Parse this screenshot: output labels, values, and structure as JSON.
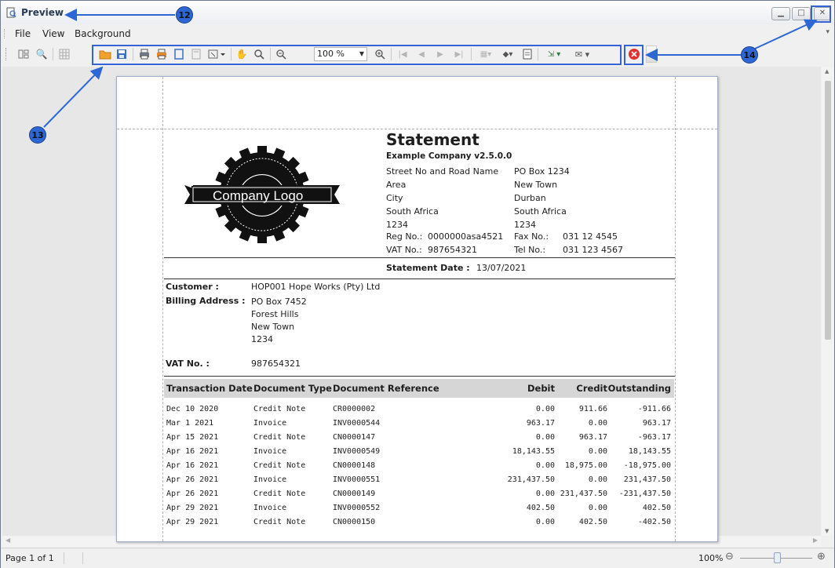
{
  "window": {
    "title": "Preview"
  },
  "menu": {
    "items": [
      "File",
      "View",
      "Background"
    ]
  },
  "toolbar": {
    "zoom_value": "100 %"
  },
  "annotations": [
    "12",
    "13",
    "14"
  ],
  "statusbar": {
    "page_info": "Page 1 of 1",
    "zoom_level": "100%"
  },
  "document": {
    "logo_text": "Company Logo",
    "title": "Statement",
    "company": "Example Company v2.5.0.0",
    "address_left": [
      "Street No and Road Name",
      "Area",
      "City",
      "South Africa",
      "1234"
    ],
    "address_right": [
      "PO Box 1234",
      "New Town",
      "Durban",
      "South Africa",
      "1234"
    ],
    "reg_label": "Reg No.:",
    "reg_value": "0000000asa4521",
    "fax_label": "Fax No.:",
    "fax_value": "031 12 4545",
    "vat_label": "VAT No.:",
    "vat_value": "987654321",
    "tel_label": "Tel No.:",
    "tel_value": "031 123 4567",
    "statement_date_label": "Statement Date :",
    "statement_date": "13/07/2021",
    "customer_label": "Customer :",
    "customer_value": "HOP001 Hope Works (Pty) Ltd",
    "billing_label": "Billing Address :",
    "billing_lines": [
      "PO Box 7452",
      "Forest Hills",
      "New Town",
      "1234"
    ],
    "cust_vat_label": "VAT No. :",
    "cust_vat_value": "987654321",
    "columns": [
      "Transaction Date",
      "Document Type",
      "Document Reference",
      "Debit",
      "Credit",
      "Outstanding"
    ],
    "rows": [
      [
        "Dec 10 2020",
        "Credit Note",
        "CR0000002",
        "0.00",
        "911.66",
        "-911.66"
      ],
      [
        "Mar 1 2021",
        "Invoice",
        "INV0000544",
        "963.17",
        "0.00",
        "963.17"
      ],
      [
        "Apr 15 2021",
        "Credit Note",
        "CN0000147",
        "0.00",
        "963.17",
        "-963.17"
      ],
      [
        "Apr 16 2021",
        "Invoice",
        "INV0000549",
        "18,143.55",
        "0.00",
        "18,143.55"
      ],
      [
        "Apr 16 2021",
        "Credit Note",
        "CN0000148",
        "0.00",
        "18,975.00",
        "-18,975.00"
      ],
      [
        "Apr 26 2021",
        "Invoice",
        "INV0000551",
        "231,437.50",
        "0.00",
        "231,437.50"
      ],
      [
        "Apr 26 2021",
        "Credit Note",
        "CN0000149",
        "0.00",
        "231,437.50",
        "-231,437.50"
      ],
      [
        "Apr 29 2021",
        "Invoice",
        "INV0000552",
        "402.50",
        "0.00",
        "402.50"
      ],
      [
        "Apr 29 2021",
        "Credit Note",
        "CN0000150",
        "0.00",
        "402.50",
        "-402.50"
      ]
    ]
  },
  "colors": {
    "annotation_blue": "#2e67d4",
    "highlight_blue": "#3563d6",
    "close_red": "#e0312f"
  }
}
